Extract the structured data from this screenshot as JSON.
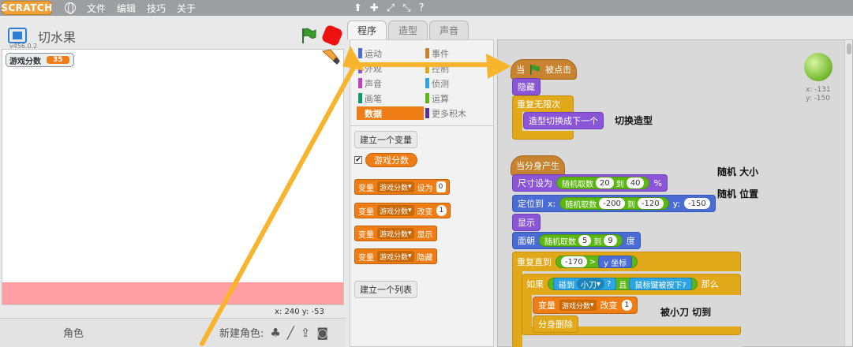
{
  "menubar": {
    "logo": "SCRATCH",
    "file": "文件",
    "edit": "编辑",
    "tips": "技巧",
    "about": "关于",
    "tools": [
      "⬆",
      "✚",
      "⤢",
      "⤡",
      "?"
    ]
  },
  "stage": {
    "title": "切水果",
    "version": "v456.0.2",
    "monitor_label": "游戏分数",
    "monitor_value": "35",
    "coords_x_label": "x:",
    "coords_x": "240",
    "coords_y_label": "y:",
    "coords_y": "-53"
  },
  "sprites": {
    "label": "角色",
    "new_sprite": "新建角色:"
  },
  "tabs": [
    "程序",
    "造型",
    "声音"
  ],
  "palette": {
    "categories": [
      {
        "label": "运动",
        "color": "#4a6cd4"
      },
      {
        "label": "事件",
        "color": "#c88330"
      },
      {
        "label": "外观",
        "color": "#8a55d7"
      },
      {
        "label": "控制",
        "color": "#e1a91a"
      },
      {
        "label": "声音",
        "color": "#bb42c3"
      },
      {
        "label": "侦测",
        "color": "#2ca5e2"
      },
      {
        "label": "画笔",
        "color": "#0e9a6c"
      },
      {
        "label": "运算",
        "color": "#5cb712"
      },
      {
        "label": "数据",
        "color": "#ee7d16"
      },
      {
        "label": "更多积木",
        "color": "#632d99"
      }
    ],
    "make_variable": "建立一个变量",
    "variable_name": "游戏分数",
    "checkmark": "✔",
    "block_var": "变量",
    "block_var_name": "游戏分数",
    "set_to": "设为",
    "set_value": "0",
    "change_by": "改变",
    "change_value": "1",
    "show": "显示",
    "hide": "隐藏",
    "make_list": "建立一个列表"
  },
  "scripts": {
    "when": "当",
    "clicked": "被点击",
    "hide": "隐藏",
    "forever": "重复无限次",
    "next_costume": "造型切换成下一个",
    "annot_costume": "切换造型",
    "clone_start": "当分身产生",
    "size_set": "尺寸设为",
    "random": "随机取数",
    "to": "到",
    "size_min": "20",
    "size_max": "40",
    "percent": "%",
    "goto": "定位到",
    "x": "x:",
    "x_min": "-200",
    "x_max": "-120",
    "y": "y:",
    "y_val": "-150",
    "show": "显示",
    "face": "面朝",
    "face_min": "5",
    "face_max": "9",
    "degree": "度",
    "repeat_until": "重复直到",
    "ry_val": "-170",
    "gt": ">",
    "y_coord": "y 坐标",
    "if": "如果",
    "touching": "碰到",
    "knife": "小刀",
    "q": "?",
    "and": "且",
    "mouse_down": "鼠标键被按下?",
    "then": "那么",
    "var": "变量",
    "var_name": "游戏分数",
    "change": "改变",
    "change_val": "1",
    "delete_clone": "分身删除",
    "annot_size": "随机 大小",
    "annot_pos": "随机 位置",
    "annot_cut": "被小刀 切到",
    "sprite_x": "x: -131",
    "sprite_y": "y: -150"
  },
  "colors": {
    "arrow": "#f7b42c",
    "data": "#ee7d16",
    "events": "#c88330",
    "looks": "#8a55d7",
    "control": "#e1a91a",
    "motion": "#4a6cd4",
    "operators": "#5cb712",
    "sensing": "#2ca5e2"
  }
}
